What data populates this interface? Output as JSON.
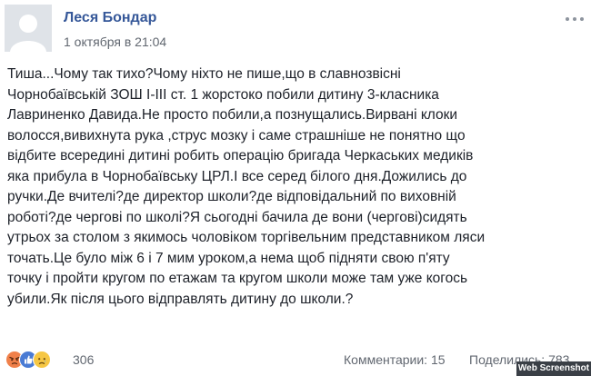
{
  "post": {
    "author": "Леся Бондар",
    "timestamp": "1 октября в 21:04",
    "more_icon": "ellipsis-horizontal-icon",
    "body_lines": [
      "Тиша...Чому так тихо?Чому ніхто не пише,що в славнозвісні",
      "Чорнобаївській ЗОШ І-ІІІ ст. 1 жорстоко побили дитину 3-класника",
      "Лавриненко Давида.Не просто побили,а познущались.Вирвані клоки",
      "волосся,вивихнута рука ,струс мозку і саме страшніше не понятно що",
      "відбите всередині дитині робить операцію бригада Черкаських медиків",
      "яка прибула в Чорнобаївську ЦРЛ.І все серед білого дня.Дожились до",
      "ручки.Де вчителі?де директор школи?де відповідальний по виховній",
      "роботі?де чергові по школі?Я сьогодні бачила де вони (чергові)сидять",
      "утрьох за столом з якимось чоловіком торгівельним представником ляси",
      "точать.Це було між 6 і 7 мим уроком,а нема щоб підняти свою п'яту",
      "точку і пройти кругом по етажам та кругом школи може там уже когось",
      "убили.Як після цього відправлять дитину до школи.?"
    ]
  },
  "footer": {
    "reactions": [
      "angry-reaction-icon",
      "like-reaction-icon",
      "sad-reaction-icon"
    ],
    "reaction_count": "306",
    "comments": "Комментарии: 15",
    "shares": "Поделились: 783"
  },
  "watermark": "Web Screenshot",
  "colors": {
    "author": "#365899",
    "meta": "#616770",
    "text": "#1d2129",
    "angry": "#f0804a",
    "like": "#4a7bd4",
    "sad": "#f6c744"
  }
}
